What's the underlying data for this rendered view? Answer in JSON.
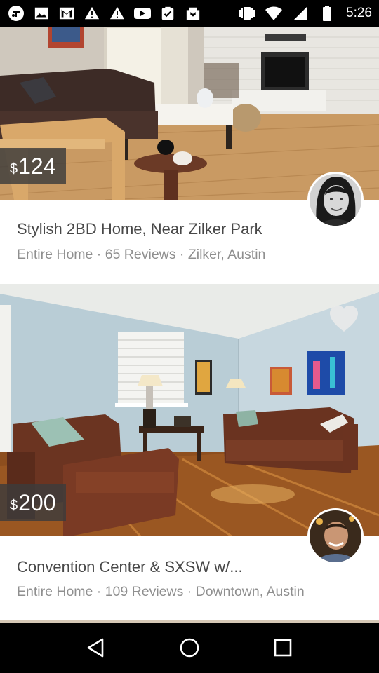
{
  "status_bar": {
    "time": "5:26",
    "icons": [
      "foursquare-icon",
      "gallery-icon",
      "gmail-icon",
      "warning-icon",
      "warning-icon",
      "youtube-icon",
      "tasks-icon",
      "photos-icon",
      "vibrate-icon",
      "wifi-icon",
      "cellular-signal-icon",
      "battery-icon"
    ]
  },
  "listings": [
    {
      "price_currency": "$",
      "price_value": "124",
      "title": "Stylish 2BD Home, Near Zilker Park",
      "meta": "Entire Home · 65 Reviews · Zilker, Austin",
      "host_avatar": "host-avatar-woman",
      "favorited": false
    },
    {
      "price_currency": "$",
      "price_value": "200",
      "title": "Convention Center & SXSW w/...",
      "meta": "Entire Home · 109 Reviews · Downtown, Austin",
      "host_avatar": "host-avatar-man",
      "favorited": false
    }
  ],
  "nav_bar": {
    "buttons": [
      "back-icon",
      "home-icon",
      "recents-icon"
    ]
  },
  "colors": {
    "status_bar_bg": "#000000",
    "price_tag_bg": "#3c3c3c",
    "title_text": "#484848",
    "meta_text": "#8f8f8f",
    "card_bg": "#ffffff",
    "page_bg": "#efefef"
  }
}
